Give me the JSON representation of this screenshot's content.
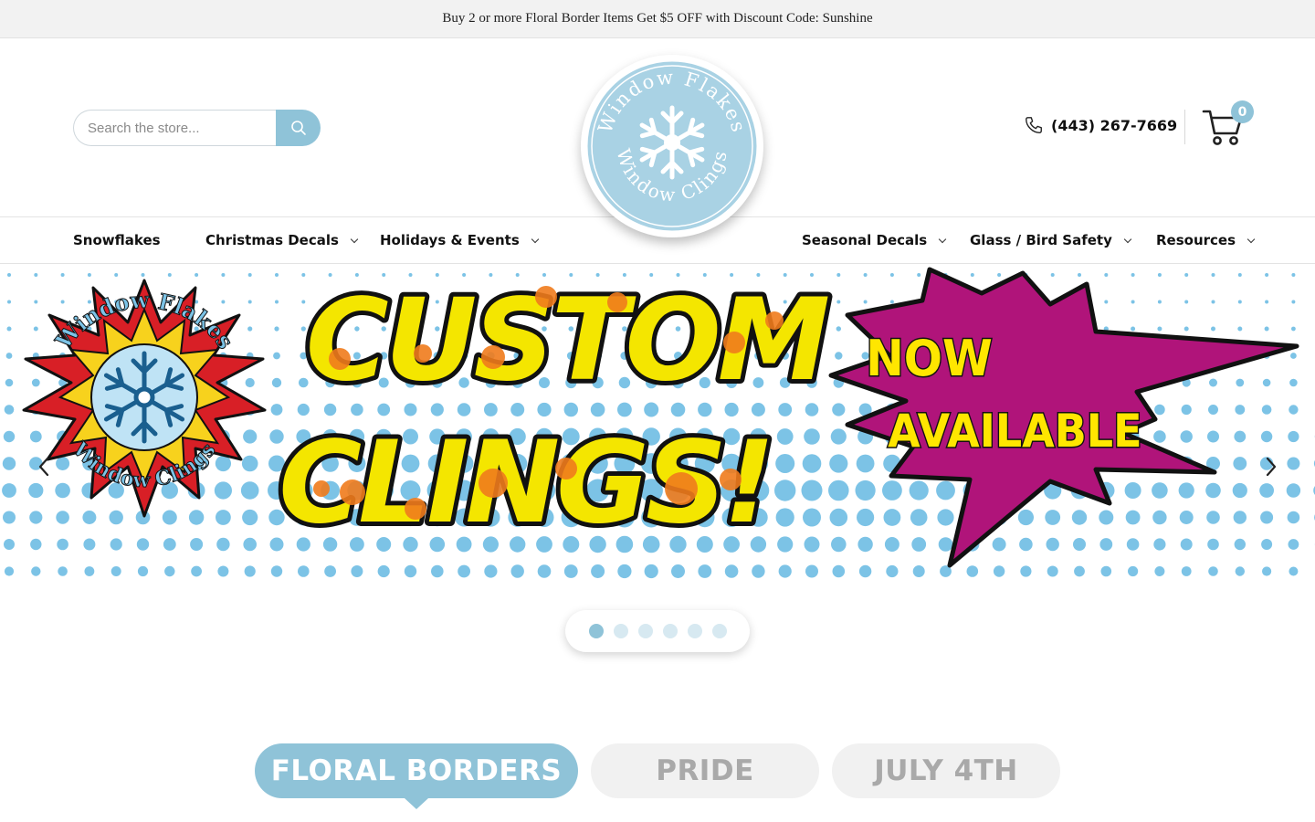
{
  "announcement": {
    "text": "Buy 2 or more Floral Border Items Get $5 OFF with Discount Code: Sunshine"
  },
  "header": {
    "search": {
      "placeholder": "Search the store..."
    },
    "logo": {
      "top_text": "Window Flakes",
      "bottom_text": "Window Clings"
    },
    "phone": "(443) 267-7669",
    "cart": {
      "count": "0"
    }
  },
  "nav": {
    "items": [
      {
        "label": "Snowflakes",
        "has_dropdown": false
      },
      {
        "label": "Christmas Decals",
        "has_dropdown": true
      },
      {
        "label": "Holidays & Events",
        "has_dropdown": true
      },
      {
        "label": "Seasonal Decals",
        "has_dropdown": true
      },
      {
        "label": "Glass / Bird Safety",
        "has_dropdown": true
      },
      {
        "label": "Resources",
        "has_dropdown": true
      }
    ]
  },
  "hero": {
    "headline_line1": "CUSTOM",
    "headline_line2": "CLINGS!",
    "burst_line1": "NOW",
    "burst_line2": "AVAILABLE",
    "badge_top_text": "Window Flakes",
    "badge_bottom_text": "Window Clings",
    "slide_count": 6,
    "active_slide": 1
  },
  "collection_tabs": [
    {
      "label": "FLORAL BORDERS",
      "active": true
    },
    {
      "label": "PRIDE",
      "active": false
    },
    {
      "label": "JULY 4TH",
      "active": false
    }
  ],
  "colors": {
    "accent": "#8fc3d8",
    "accent_light": "#d7e9f1",
    "halftone_blue": "#7cc3e6",
    "headline_yellow": "#f4e600",
    "headline_orange": "#f07b1c",
    "burst_magenta": "#b0147a",
    "burst_text": "#ffe600",
    "badge_red": "#d81f26"
  },
  "icons": [
    "search-icon",
    "phone-icon",
    "cart-icon",
    "chevron-down-icon",
    "chevron-left-icon",
    "chevron-right-icon",
    "snowflake-icon"
  ]
}
